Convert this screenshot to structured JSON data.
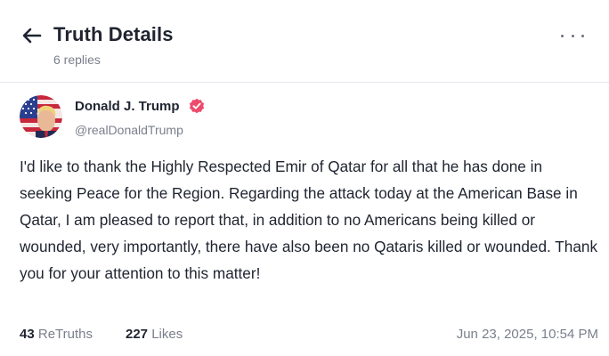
{
  "header": {
    "title": "Truth Details",
    "replies": "6 replies"
  },
  "post": {
    "author": {
      "name": "Donald J. Trump",
      "handle": "@realDonaldTrump",
      "verified_color": "#ee4a6b"
    },
    "text": "I'd like to thank the Highly Respected Emir of Qatar for all that he has done in seeking Peace for the Region. Regarding the attack today at the American Base in Qatar, I am pleased to report that, in addition to no Americans being killed or wounded, very importantly, there have also been no Qataris killed or wounded. Thank you for your attention to this matter!",
    "stats": {
      "retruths_count": "43",
      "retruths_label": "ReTruths",
      "likes_count": "227",
      "likes_label": "Likes"
    },
    "timestamp": "Jun 23, 2025, 10:54 PM"
  },
  "icons": {
    "back": "arrow-left-icon",
    "more": "more-horizontal-icon",
    "verified": "verified-badge-icon"
  },
  "colors": {
    "text_primary": "#1f2430",
    "text_secondary": "#7a7f8c",
    "accent": "#ee4a6b"
  }
}
